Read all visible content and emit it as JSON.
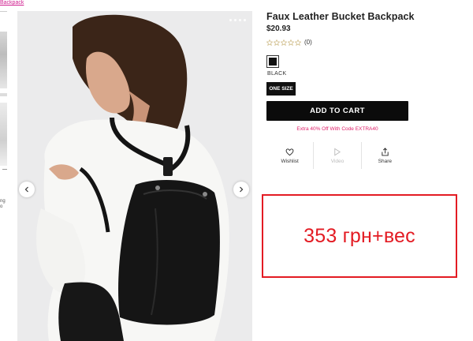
{
  "breadcrumb": {
    "link": "Backpack"
  },
  "left_panel": {
    "snippet_1": "ng",
    "snippet_2": "o"
  },
  "product": {
    "title": "Faux Leather Bucket Backpack",
    "price": "$20.93",
    "review_count": "(0)",
    "color": {
      "name": "BLACK",
      "hex": "#111111"
    },
    "size": "ONE SIZE",
    "add_to_cart": "ADD TO CART",
    "promo": "Extra 40% Off With Code EXTRA40"
  },
  "actions": [
    {
      "label": "Wishlist",
      "icon": "heart-icon"
    },
    {
      "label": "Video",
      "icon": "play-icon"
    },
    {
      "label": "Share",
      "icon": "share-icon"
    }
  ],
  "annotation": {
    "text": "353 грн+вес",
    "color": "#e31b23"
  }
}
